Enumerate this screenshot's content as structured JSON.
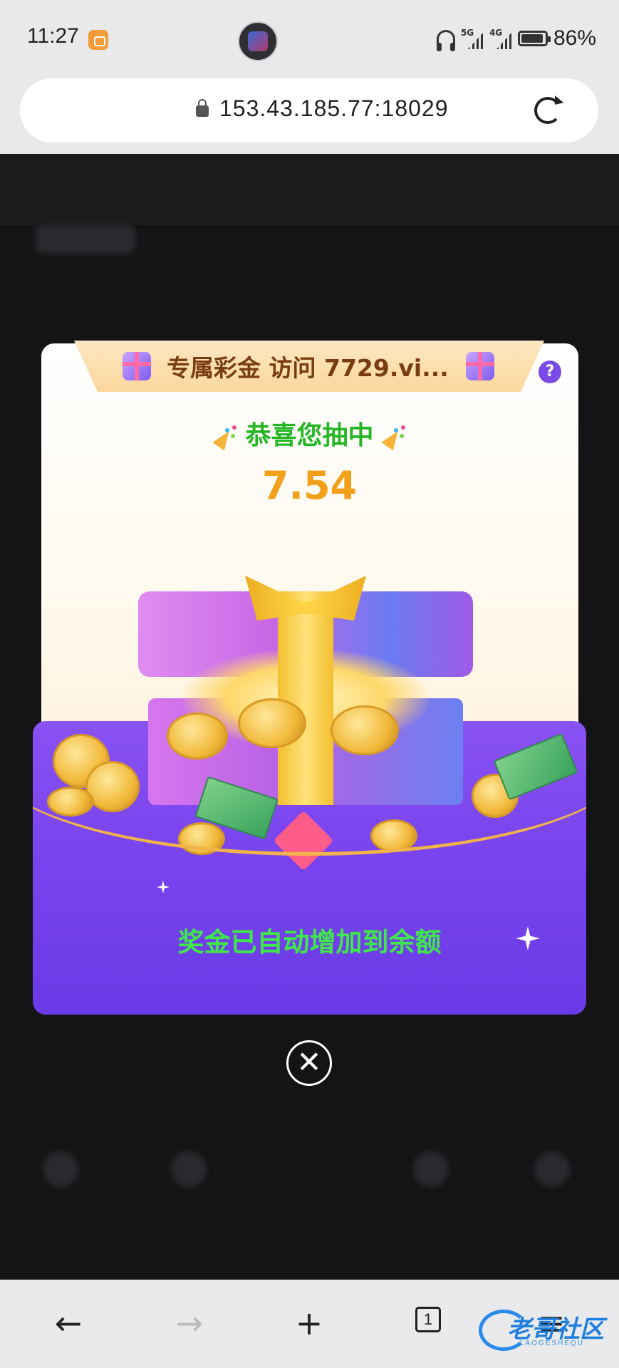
{
  "status_bar": {
    "time": "11:27",
    "battery_percent": "86%",
    "network_1": "5G",
    "network_2": "4G"
  },
  "browser": {
    "url": "153.43.185.77:18029",
    "tab_count": "1"
  },
  "modal": {
    "header_text": "专属彩金 访问 7729.vi...",
    "help_label": "?",
    "congrats_text": "恭喜您抽中",
    "amount": "7.54",
    "bonus_message": "奖金已自动增加到余额",
    "close_label": "✕"
  },
  "nav": {
    "back_label": "←",
    "forward_label": "→",
    "new_tab_label": "+",
    "menu_label": "≡"
  },
  "watermark": {
    "text": "老哥社区",
    "subtext": "LAOGESHEQU"
  },
  "colors": {
    "accent_purple": "#7b45ef",
    "amount_orange": "#f2a019",
    "congrats_green": "#25b624",
    "bonus_green": "#3ee84a"
  }
}
